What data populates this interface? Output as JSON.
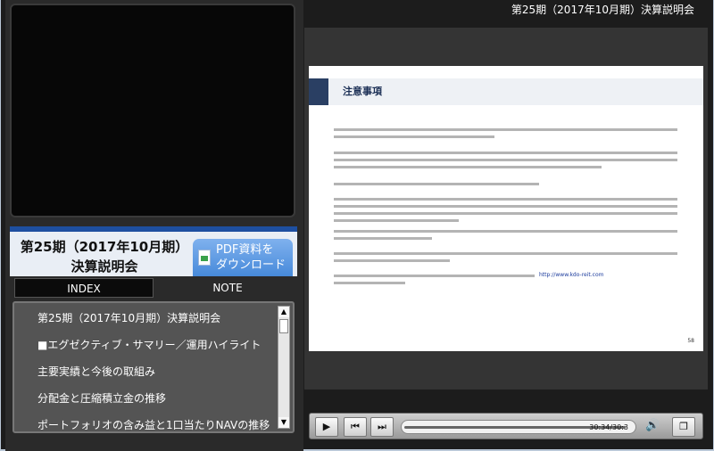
{
  "header": {
    "title": "第25期（2017年10月期）決算説明会"
  },
  "banner": {
    "title_line1": "第25期（2017年10月期）",
    "title_line2": "決算説明会",
    "pdf_button_line1": "PDF資料を",
    "pdf_button_line2": "ダウンロード"
  },
  "tabs": {
    "index": "INDEX",
    "note": "NOTE"
  },
  "index_items": [
    "第25期（2017年10月期）決算説明会",
    "■エグゼクティブ・サマリー／運用ハイライト",
    "主要実績と今後の取組み",
    "分配金と圧縮積立金の推移",
    "ポートフォリオの含み益と1口当たりNAVの推移"
  ],
  "slide": {
    "title": "注意事項",
    "url": "http://www.kdo-reit.com",
    "page": "58"
  },
  "player": {
    "time": "30:34/30:3",
    "progress_fraction": 0.99,
    "play_icon": "play-icon",
    "prev_icon": "skip-back-icon",
    "next_icon": "skip-forward-icon",
    "volume_icon": "volume-icon",
    "window_icon": "popout-window-icon"
  }
}
